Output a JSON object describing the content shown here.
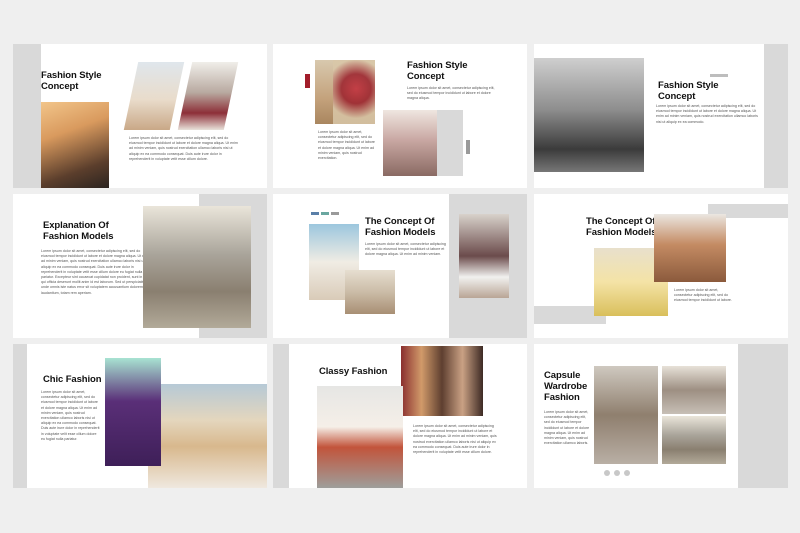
{
  "slides": {
    "s1": {
      "title": "Fashion Style Concept",
      "body": "Lorem ipsum dolor sit amet, consectetur adipiscing elit, sed do eiusmod tempor incididunt ut labore et dolore magna aliqua. Ut enim ad minim veniam, quis nostrud exercitation ullamco laboris nisi ut aliquip ex ea commodo consequat. Duis aute irure dolor in reprehenderit in voluptate velit esse cillum dolore."
    },
    "s2": {
      "title": "Fashion Style Concept",
      "body": "Lorem ipsum dolor sit amet, consectetur adipiscing elit, sed do eiusmod tempor incididunt ut labore et dolore magna aliqua.",
      "body2": "Lorem ipsum dolor sit amet, consectetur adipiscing elit, sed do eiusmod tempor incididunt ut labore et dolore magna aliqua. Ut enim ad minim veniam, quis nostrud exercitation."
    },
    "s3": {
      "title": "Fashion Style Concept",
      "body": "Lorem ipsum dolor sit amet, consectetur adipiscing elit, sed do eiusmod tempor incididunt ut labore et dolore magna aliqua. Ut enim ad minim veniam, quis nostrud exercitation ullamco laboris nisi ut aliquip ex ea commodo."
    },
    "s4": {
      "title": "Explanation Of Fashion Models",
      "body": "Lorem ipsum dolor sit amet, consectetur adipiscing elit, sed do eiusmod tempor incididunt ut labore et dolore magna aliqua. Ut enim ad minim veniam, quis nostrud exercitation ullamco laboris nisi ut aliquip ex ea commodo consequat. Duis aute irure dolor in reprehenderit in voluptate velit esse cillum dolore eu fugiat nulla pariatur. Excepteur sint occaecat cupidatat non proident, sunt in culpa qui officia deserunt mollit anim id est laborum. Sed ut perspiciatis unde omnis iste natus error sit voluptatem accusantium doloremque laudantium, totam rem aperiam."
    },
    "s5": {
      "title": "The Concept Of Fashion Models",
      "body": "Lorem ipsum dolor sit amet, consectetur adipiscing elit, sed do eiusmod tempor incididunt ut labore et dolore magna aliqua. Ut enim ad minim veniam."
    },
    "s6": {
      "title": "The Concept Of Fashion Models",
      "body": "Lorem ipsum dolor sit amet, consectetur adipiscing elit, sed do eiusmod tempor incididunt ut labore."
    },
    "s7": {
      "title": "Chic Fashion",
      "body": "Lorem ipsum dolor sit amet, consectetur adipiscing elit, sed do eiusmod tempor incididunt ut labore et dolore magna aliqua. Ut enim ad minim veniam, quis nostrud exercitation ullamco laboris nisi ut aliquip ex ea commodo consequat. Duis aute irure dolor in reprehenderit in voluptate velit esse cillum dolore eu fugiat nulla pariatur."
    },
    "s8": {
      "title": "Classy Fashion",
      "body": "Lorem ipsum dolor sit amet, consectetur adipiscing elit, sed do eiusmod tempor incididunt ut labore et dolore magna aliqua. Ut enim ad minim veniam, quis nostrud exercitation ullamco laboris nisi ut aliquip ex ea commodo consequat. Duis aute irure dolor in reprehenderit in voluptate velit esse cillum dolore."
    },
    "s9": {
      "title": "Capsule Wardrobe Fashion",
      "body": "Lorem ipsum dolor sit amet, consectetur adipiscing elit, sed do eiusmod tempor incididunt ut labore et dolore magna aliqua. Ut enim ad minim veniam, quis nostrud exercitation ullamco laboris."
    }
  },
  "colors": {
    "accent_red": "#a21d2a",
    "accent_gray": "#9a9a9a",
    "accent_blue": "#5a7fa8",
    "accent_teal": "#6aa7a0",
    "panel_gray": "#d9d9d9"
  },
  "pagination": {
    "dots": 3
  }
}
